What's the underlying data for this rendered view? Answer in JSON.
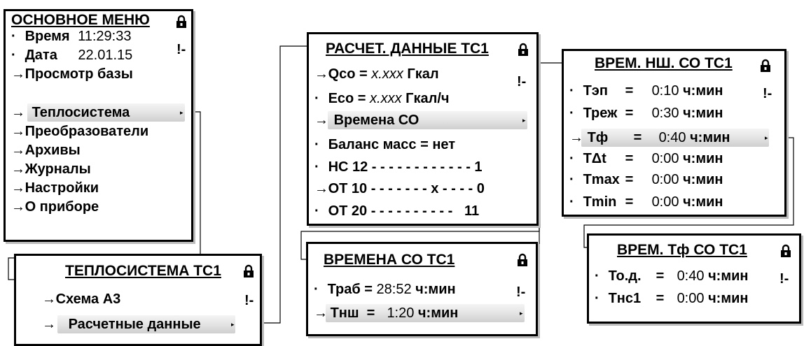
{
  "markers": {
    "arrow": "→",
    "dot": "·"
  },
  "icons": {
    "lock": "lock-icon",
    "alert": "alert-icon",
    "submenu": "submenu-indicator-icon"
  },
  "main_menu": {
    "title": "ОСНОВНОЕ МЕНЮ",
    "status": "!-",
    "items": [
      {
        "marker": "·",
        "label": "Время",
        "value": "11:29:33"
      },
      {
        "marker": "·",
        "label": "Дата",
        "value": "22.01.15"
      },
      {
        "marker": "→",
        "label": "Просмотр базы"
      },
      {
        "marker": "→",
        "label": "Теплосистема",
        "selected": true
      },
      {
        "marker": "→",
        "label": "Преобразователи"
      },
      {
        "marker": "→",
        "label": "Архивы"
      },
      {
        "marker": "→",
        "label": "Журналы"
      },
      {
        "marker": "→",
        "label": "Настройки"
      },
      {
        "marker": "→",
        "label": "О приборе"
      }
    ]
  },
  "heat_system": {
    "title": "ТЕПЛОСИСТЕМА ТС1",
    "status": "!-",
    "items": [
      {
        "marker": "→",
        "label": "Схема А3"
      },
      {
        "marker": "→",
        "label": "Расчетные данные",
        "selected": true
      }
    ]
  },
  "calc_data": {
    "title": "РАСЧЕТ. ДАННЫЕ ТС1",
    "status": "!-",
    "items": [
      {
        "marker": "→",
        "label": "Qсо = ",
        "value": "x.xxx",
        "unit": " Гкал"
      },
      {
        "marker": "·",
        "label": "Есо = ",
        "value": "x.xxx",
        "unit": " Гкал/ч"
      },
      {
        "marker": "→",
        "label": "Времена СО",
        "selected": true
      },
      {
        "marker": "·",
        "label": "Баланс масс = нет"
      },
      {
        "marker": "·",
        "label": "НС 12 - - - - - - - - - - - - 1"
      },
      {
        "marker": "→",
        "label": "ОТ 10 - - - - - - - x - - - - 0"
      },
      {
        "marker": "·",
        "label": "ОТ 20 - - - - - - - - - -   11"
      }
    ]
  },
  "co_times": {
    "title": "ВРЕМЕНА СО ТС1",
    "status": "!-",
    "items": [
      {
        "marker": "·",
        "label": "Траб",
        "eq": " = ",
        "value": "28:52",
        "unit": " ч:мин"
      },
      {
        "marker": "→",
        "label": "Тнш",
        "eq": "  =  ",
        "value": "1:20",
        "unit": " ч:мин",
        "selected": true
      }
    ]
  },
  "ns_times": {
    "title": "ВРЕМ. НШ. СО ТС1",
    "status": "!-",
    "items": [
      {
        "marker": "·",
        "label": "Тэп",
        "eq": "=",
        "value": "0:10",
        "unit": "ч:мин"
      },
      {
        "marker": "·",
        "label": "Треж",
        "eq": "=",
        "value": "0:30",
        "unit": "ч:мин"
      },
      {
        "marker": "→",
        "label": "Тф",
        "eq": "=",
        "value": "0:40",
        "unit": "ч:мин",
        "selected": true
      },
      {
        "marker": "·",
        "label": "ТΔt",
        "eq": "=",
        "value": "0:00",
        "unit": "ч:мин"
      },
      {
        "marker": "·",
        "label": "Тmax",
        "eq": "=",
        "value": "0:00",
        "unit": "ч:мин"
      },
      {
        "marker": "·",
        "label": "Тmin",
        "eq": "=",
        "value": "0:00",
        "unit": "ч:мин"
      }
    ]
  },
  "tf_times": {
    "title": "ВРЕМ. Тф СО ТС1",
    "status": "!-",
    "items": [
      {
        "marker": "·",
        "label": "То.д.",
        "eq": "=",
        "value": "0:40",
        "unit": "ч:мин"
      },
      {
        "marker": "·",
        "label": "Тнс1",
        "eq": "=",
        "value": "0:00",
        "unit": "ч:мин"
      }
    ]
  }
}
